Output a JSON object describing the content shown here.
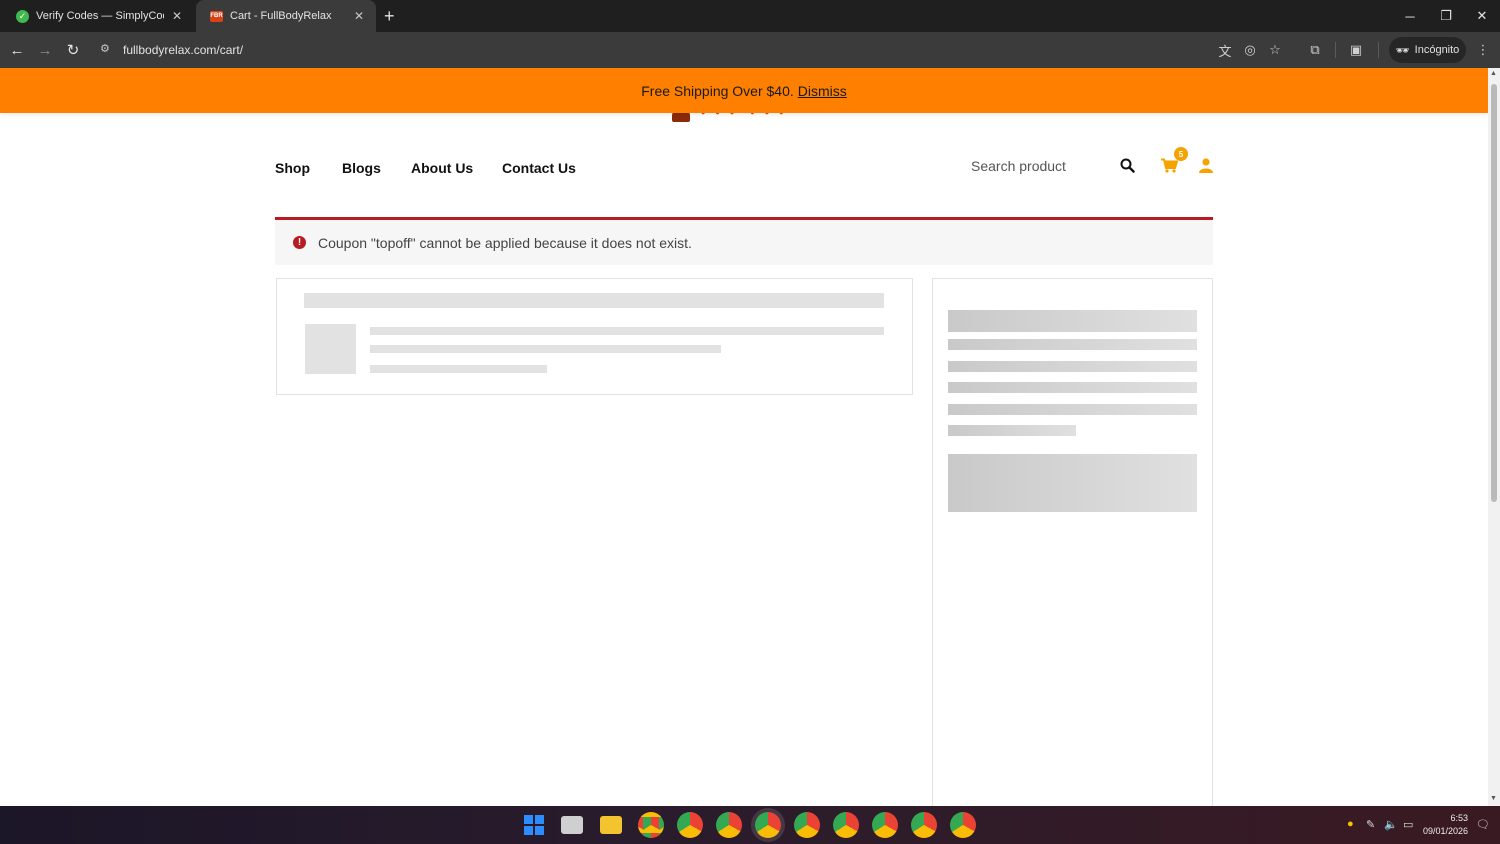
{
  "browser": {
    "tabs": [
      {
        "title": "Verify Codes — SimplyCodes",
        "favicon": "check-circle-icon"
      },
      {
        "title": "Cart - FullBodyRelax",
        "favicon": "fbr-logo-icon",
        "favicon_text": "FBR",
        "active": true
      }
    ],
    "url": "fullbodyrelax.com/cart/",
    "incognito_label": "Incógnito"
  },
  "promo": {
    "text": "Free Shipping Over $40.",
    "dismiss": "Dismiss",
    "color": "#ff7f00"
  },
  "nav": {
    "items": [
      "Shop",
      "Blogs",
      "About Us",
      "Contact Us"
    ],
    "search_placeholder": "Search product",
    "cart_count": "5",
    "accent": "#f5a300"
  },
  "notice": {
    "message": "Coupon \"topoff\" cannot be applied because it does not exist.",
    "type": "error",
    "color": "#b81c23"
  },
  "taskbar": {
    "time": "6:53",
    "date": "09/01/2026"
  }
}
